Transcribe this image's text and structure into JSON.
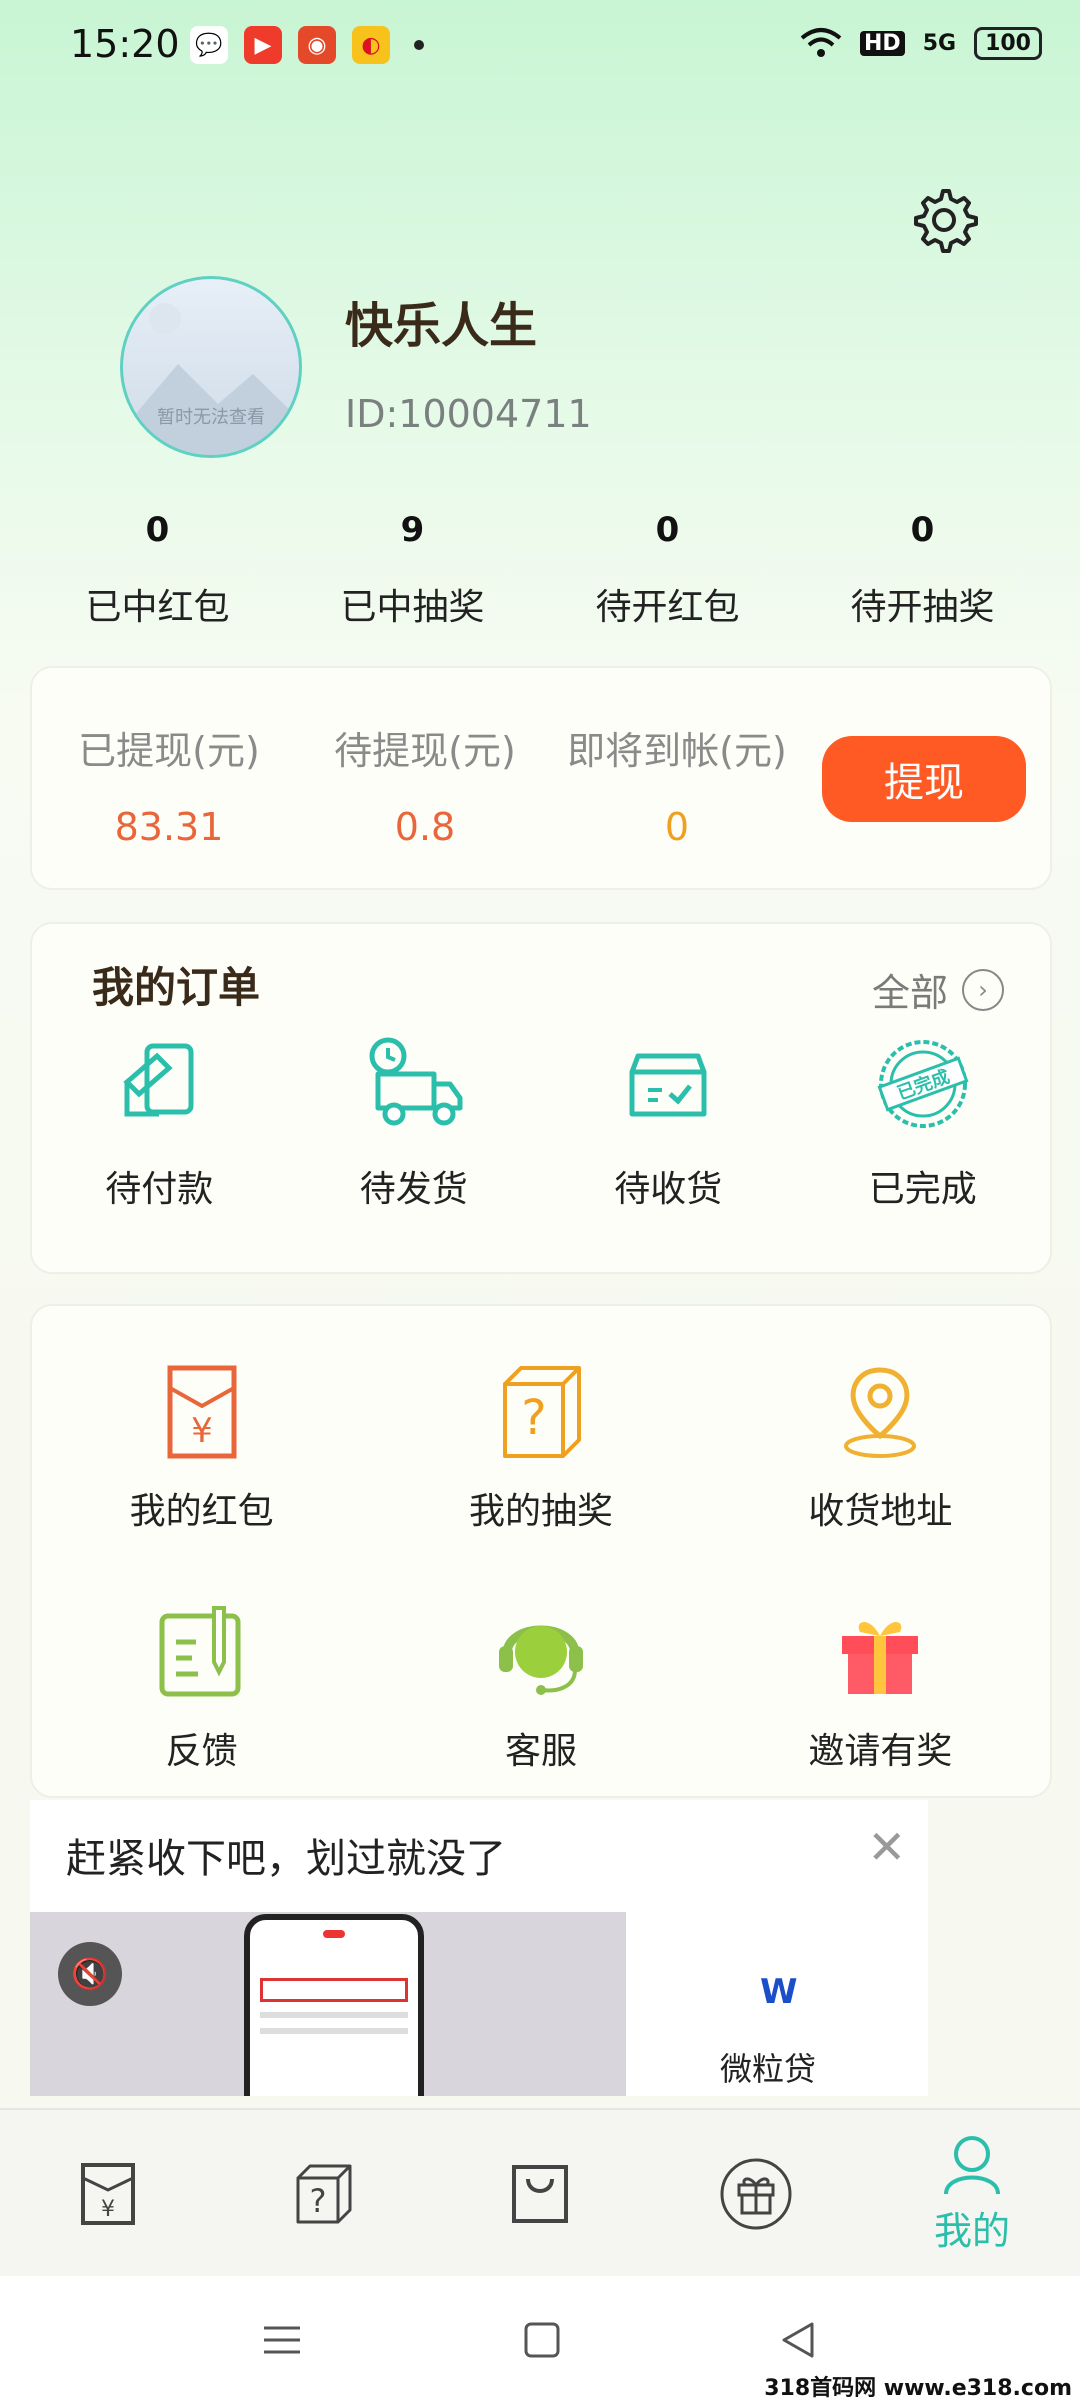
{
  "status_bar": {
    "time": "15:20",
    "network": "5G",
    "hd": "HD",
    "battery": "100"
  },
  "profile": {
    "username": "快乐人生",
    "id_text": "ID:10004711",
    "avatar_note": "暂时无法查看"
  },
  "stats": [
    {
      "value": "0",
      "label": "已中红包"
    },
    {
      "value": "9",
      "label": "已中抽奖"
    },
    {
      "value": "0",
      "label": "待开红包"
    },
    {
      "value": "0",
      "label": "待开抽奖"
    }
  ],
  "withdraw": {
    "items": [
      {
        "label": "已提现(元)",
        "value": "83.31",
        "color": "#e8663a"
      },
      {
        "label": "待提现(元)",
        "value": "0.8",
        "color": "#e8663a"
      },
      {
        "label": "即将到帐(元)",
        "value": "0",
        "color": "#f0a020"
      }
    ],
    "button_label": "提现"
  },
  "orders": {
    "title": "我的订单",
    "all_label": "全部",
    "items": [
      {
        "label": "待付款",
        "icon": "card-icon"
      },
      {
        "label": "待发货",
        "icon": "truck-icon"
      },
      {
        "label": "待收货",
        "icon": "box-icon"
      },
      {
        "label": "已完成",
        "icon": "completed-stamp-icon",
        "stamp_text": "已完成"
      }
    ]
  },
  "services": [
    {
      "label": "我的红包",
      "icon": "red-envelope-icon"
    },
    {
      "label": "我的抽奖",
      "icon": "question-box-icon"
    },
    {
      "label": "收货地址",
      "icon": "location-pin-icon"
    },
    {
      "label": "反馈",
      "icon": "feedback-icon"
    },
    {
      "label": "客服",
      "icon": "headset-icon"
    },
    {
      "label": "邀请有奖",
      "icon": "gift-icon"
    }
  ],
  "ad": {
    "title": "赶紧收下吧，划过就没了",
    "brand": "微粒贷",
    "logo_text": "W"
  },
  "tabbar": {
    "active_label": "我的",
    "tabs": [
      "red-envelope-tab-icon",
      "question-box-tab-icon",
      "bag-tab-icon",
      "gift-tab-icon",
      "user-tab-icon"
    ]
  },
  "watermark": "318首码网 www.e318.com",
  "colors": {
    "accent": "#2bbfab",
    "withdraw_button": "#ff5a24"
  }
}
